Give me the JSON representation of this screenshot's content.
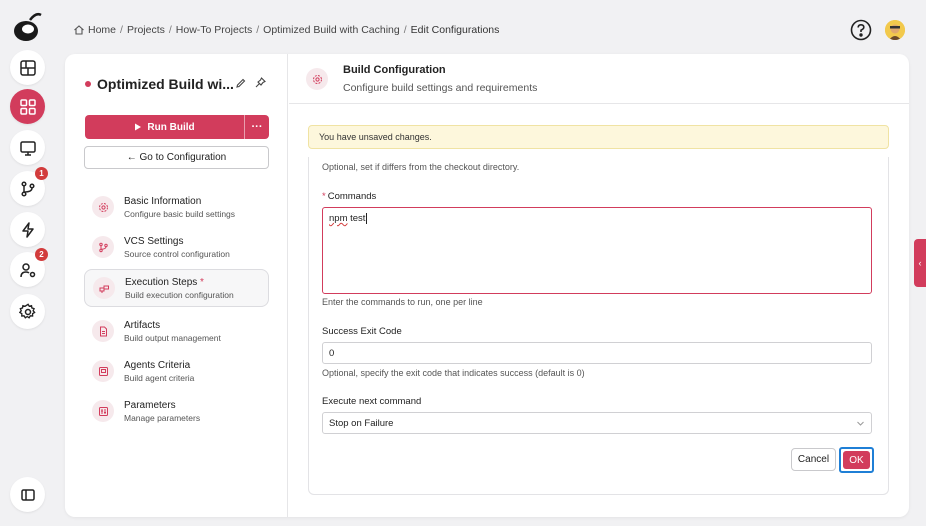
{
  "breadcrumb": {
    "items": [
      "Home",
      "Projects",
      "How-To Projects",
      "Optimized Build with Caching",
      "Edit Configurations"
    ],
    "separator": "/"
  },
  "rail": {
    "badges": {
      "vcs": "1",
      "users": "2"
    },
    "accent_color": "#d23c5c"
  },
  "project": {
    "title": "Optimized Build wi...",
    "run_label": "Run Build",
    "more_label": "···",
    "goto_label": "← Go to Configuration"
  },
  "nav": [
    {
      "title": "Basic Information",
      "subtitle": "Configure basic build settings"
    },
    {
      "title": "VCS Settings",
      "subtitle": "Source control configuration"
    },
    {
      "title": "Execution Steps",
      "required": "*",
      "subtitle": "Build execution configuration"
    },
    {
      "title": "Artifacts",
      "subtitle": "Build output management"
    },
    {
      "title": "Agents Criteria",
      "subtitle": "Build agent criteria"
    },
    {
      "title": "Parameters",
      "subtitle": "Manage parameters"
    }
  ],
  "config": {
    "title": "Build Configuration",
    "subtitle": "Configure build settings and requirements"
  },
  "warning": "You have unsaved changes.",
  "form": {
    "workdir_hint": "Optional, set if differs from the checkout directory.",
    "commands_label": "Commands",
    "commands_required": "*",
    "commands_value_word1": "npm",
    "commands_value_word2": " test",
    "commands_hint": "Enter the commands to run, one per line",
    "exit_code_label": "Success Exit Code",
    "exit_code_value": "0",
    "exit_code_hint": "Optional, specify the exit code that indicates success (default is 0)",
    "next_cmd_label": "Execute next command",
    "next_cmd_value": "Stop on Failure",
    "cancel_label": "Cancel",
    "ok_label": "OK"
  },
  "side_tab": "‹"
}
